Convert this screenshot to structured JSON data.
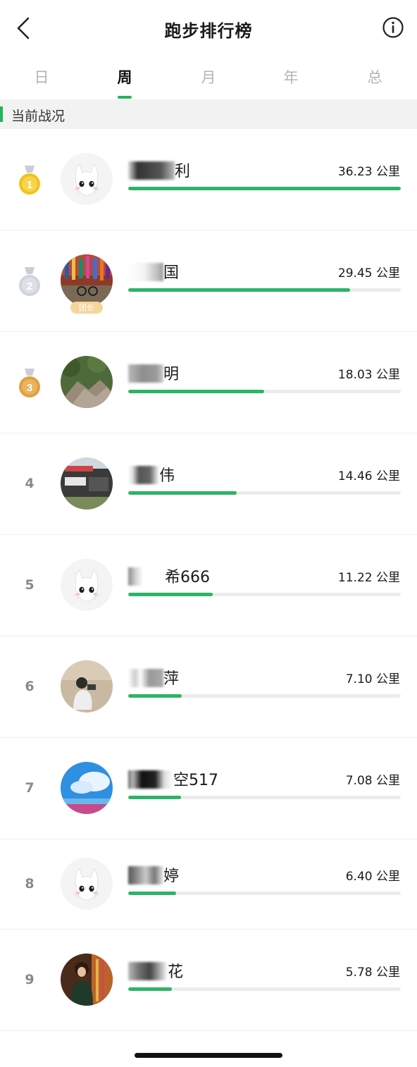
{
  "header": {
    "title": "跑步排行榜",
    "back_icon": "chevron-left-icon",
    "info_icon": "info-circle-icon"
  },
  "tabs": [
    {
      "label": "日",
      "active": false
    },
    {
      "label": "周",
      "active": true
    },
    {
      "label": "月",
      "active": false
    },
    {
      "label": "年",
      "active": false
    },
    {
      "label": "总",
      "active": false
    }
  ],
  "section": {
    "title": "当前战况"
  },
  "colors": {
    "accent": "#21b45c",
    "bar": "#2db466",
    "track": "#ececec",
    "gold": "#f0c419",
    "silver": "#c9ced6",
    "bronze": "#e6a94a"
  },
  "ranking": [
    {
      "rank": "1",
      "medal": "gold",
      "name_visible": "利",
      "distance": "36.23 公里",
      "progress": 1.0,
      "avatar": "default-bunny"
    },
    {
      "rank": "2",
      "medal": "silver",
      "name_visible": "国",
      "distance": "29.45 公里",
      "progress": 0.813,
      "avatar": "photo",
      "badge": "团长"
    },
    {
      "rank": "3",
      "medal": "bronze",
      "name_visible": "明",
      "distance": "18.03 公里",
      "progress": 0.498,
      "avatar": "photo"
    },
    {
      "rank": "4",
      "name_visible": "伟",
      "distance": "14.46 公里",
      "progress": 0.399,
      "avatar": "photo"
    },
    {
      "rank": "5",
      "name_visible": "希666",
      "distance": "11.22 公里",
      "progress": 0.31,
      "avatar": "default-bunny"
    },
    {
      "rank": "6",
      "name_visible": "萍",
      "distance": "7.10 公里",
      "progress": 0.196,
      "avatar": "photo"
    },
    {
      "rank": "7",
      "name_visible": "空517",
      "distance": "7.08 公里",
      "progress": 0.195,
      "avatar": "photo"
    },
    {
      "rank": "8",
      "name_visible": "婷",
      "distance": "6.40 公里",
      "progress": 0.177,
      "avatar": "default-bunny"
    },
    {
      "rank": "9",
      "name_visible": "花",
      "distance": "5.78 公里",
      "progress": 0.16,
      "avatar": "photo"
    }
  ]
}
